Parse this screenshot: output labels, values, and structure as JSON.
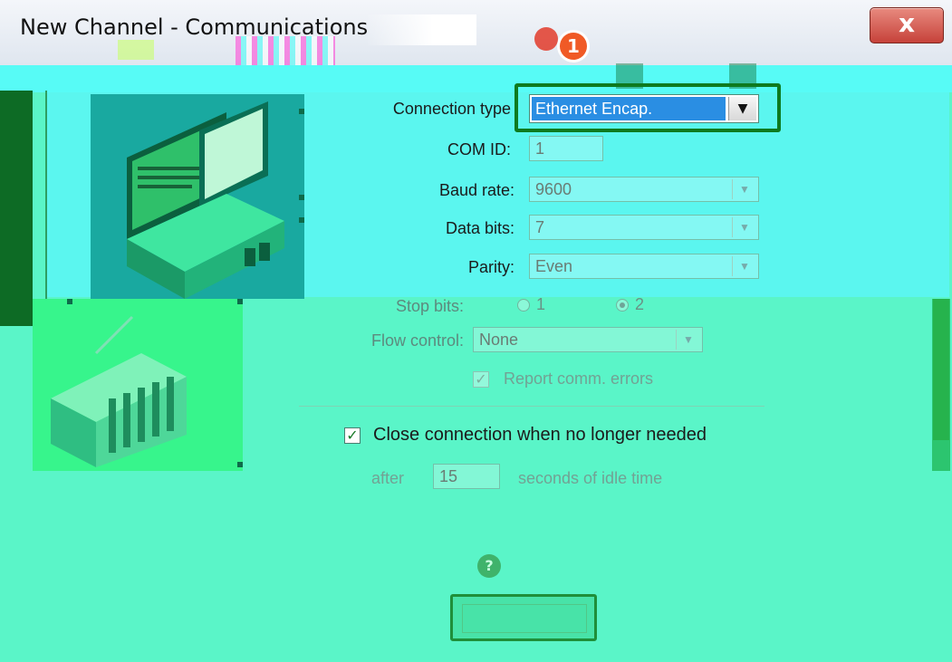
{
  "window": {
    "title": "New Channel - Communications",
    "close_glyph": "x",
    "step_badge": "1"
  },
  "form": {
    "connection_type": {
      "label": "Connection type",
      "value": "Ethernet Encap.",
      "arrow": "▼"
    },
    "com_id": {
      "label": "COM ID:",
      "value": "1"
    },
    "baud_rate": {
      "label": "Baud rate:",
      "value": "9600"
    },
    "data_bits": {
      "label": "Data bits:",
      "value": "7"
    },
    "parity": {
      "label": "Parity:",
      "value": "Even"
    },
    "stop_bits": {
      "label": "Stop bits:",
      "options": [
        "1",
        "2"
      ],
      "selected": "2"
    },
    "flow_control": {
      "label": "Flow control:",
      "value": "None"
    },
    "report_errors": {
      "label": "Report comm. errors",
      "checked": true
    },
    "close_connection": {
      "label": "Close connection when no longer needed",
      "checked": true
    },
    "idle_time": {
      "prefix": "after",
      "value": "15",
      "suffix": "seconds of idle time"
    }
  },
  "icons": {
    "close": "close-icon",
    "dropdown": "chevron-down-icon",
    "computer": "computer-illustration",
    "plc": "plc-illustration"
  },
  "colors": {
    "highlight_border": "#0e7a1f",
    "selection_bg": "#2a8ee3",
    "badge": "#f05a26"
  }
}
